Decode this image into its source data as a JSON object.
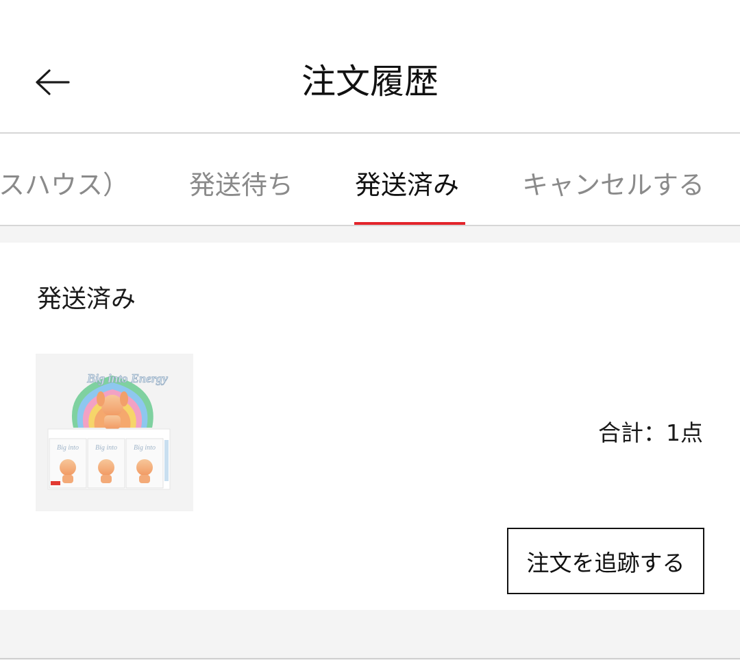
{
  "header": {
    "title": "注文履歴",
    "back_icon": "arrow-left-icon"
  },
  "tabs": [
    {
      "label": "スハウス）",
      "active": false
    },
    {
      "label": "発送待ち",
      "active": false
    },
    {
      "label": "発送済み",
      "active": true
    },
    {
      "label": "キャンセルする",
      "active": false
    }
  ],
  "order": {
    "status": "発送済み",
    "product_image": "product-box-image",
    "product_image_text": "Big into Energy",
    "total": "合計：1点",
    "track_button": "注文を追跡する"
  },
  "colors": {
    "accent": "#e3242b",
    "background_gray": "#f4f4f4",
    "divider": "#d6d6d6"
  }
}
